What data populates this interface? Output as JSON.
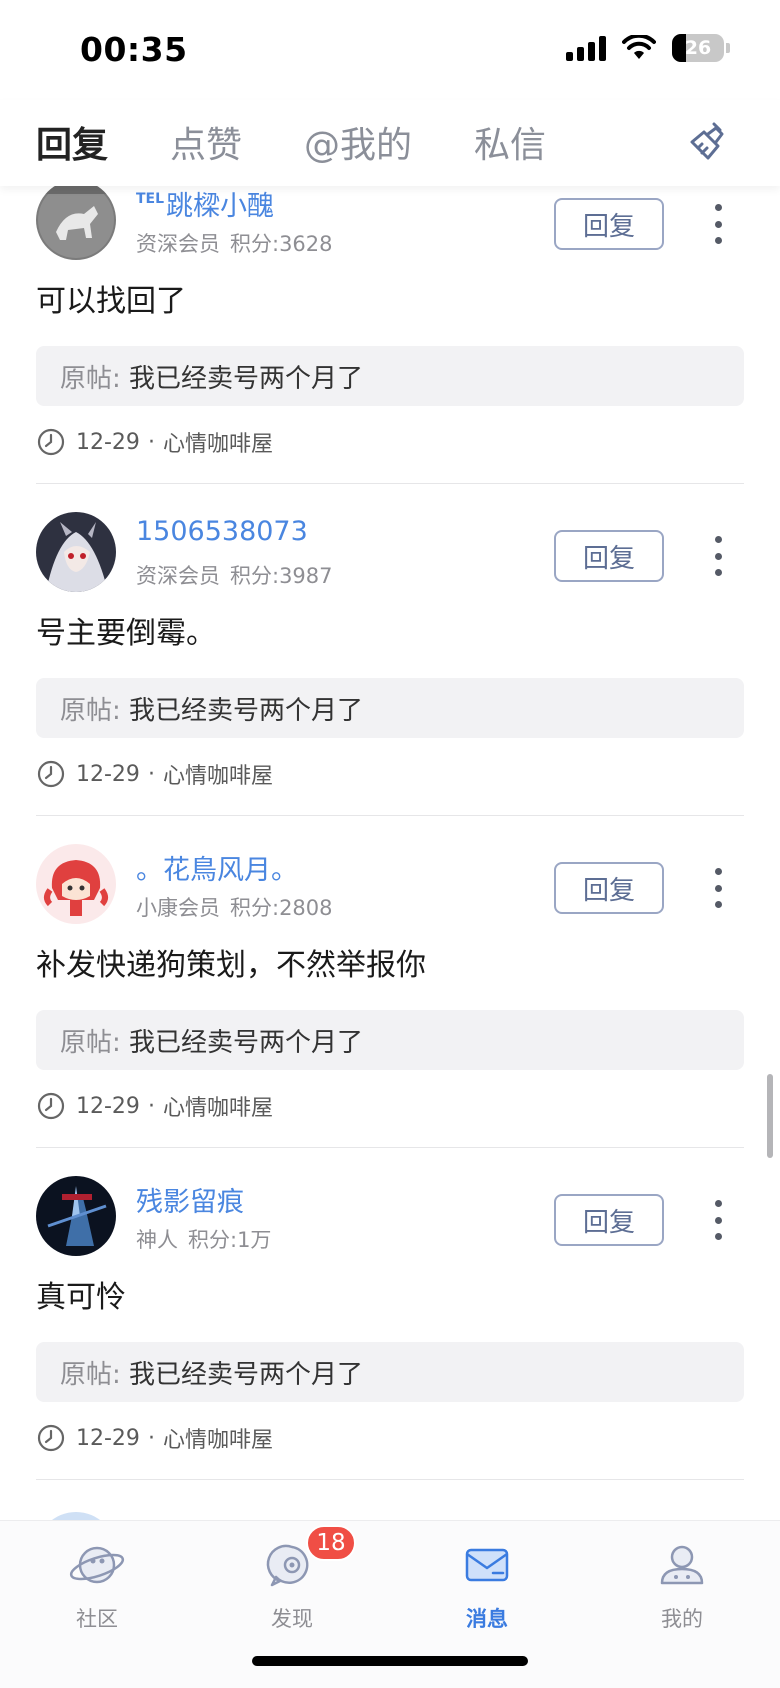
{
  "status_bar": {
    "time": "00:35",
    "battery": "26",
    "battery_level": 0.26
  },
  "tabs": [
    {
      "label": "回复",
      "active": true
    },
    {
      "label": "点赞",
      "active": false
    },
    {
      "label": "@我的",
      "active": false
    },
    {
      "label": "私信",
      "active": false
    }
  ],
  "clean_icon": "broom-icon",
  "reply_button_label": "回复",
  "items": [
    {
      "username_prefix": "TEL",
      "username": "跳樑小醜",
      "level": "资深会员",
      "points": "积分:3628",
      "content": "可以找回了",
      "origin_prefix": "原帖:",
      "origin_text": "我已经卖号两个月了",
      "date": "12-29",
      "separator": "·",
      "board": "心情咖啡屋"
    },
    {
      "username_prefix": "",
      "username": "1506538073",
      "level": "资深会员",
      "points": "积分:3987",
      "content": "号主要倒霉。",
      "origin_prefix": "原帖:",
      "origin_text": "我已经卖号两个月了",
      "date": "12-29",
      "separator": "·",
      "board": "心情咖啡屋"
    },
    {
      "username_prefix": "",
      "username": "。花鳥风月。",
      "level": "小康会员",
      "points": "积分:2808",
      "content": "补发快递狗策划，不然举报你",
      "origin_prefix": "原帖:",
      "origin_text": "我已经卖号两个月了",
      "date": "12-29",
      "separator": "·",
      "board": "心情咖啡屋"
    },
    {
      "username_prefix": "",
      "username": "残影留痕",
      "level": "神人",
      "points": "积分:1万",
      "content": "真可怜",
      "origin_prefix": "原帖:",
      "origin_text": "我已经卖号两个月了",
      "date": "12-29",
      "separator": "·",
      "board": "心情咖啡屋"
    }
  ],
  "bottom_nav": [
    {
      "label": "社区",
      "icon": "planet-icon",
      "active": false
    },
    {
      "label": "发现",
      "icon": "discover-icon",
      "active": false,
      "badge": "18"
    },
    {
      "label": "消息",
      "icon": "mail-icon",
      "active": true
    },
    {
      "label": "我的",
      "icon": "profile-icon",
      "active": false
    }
  ],
  "colors": {
    "accent": "#3a7be0",
    "username": "#4a86e0",
    "badge": "#f04e45"
  }
}
